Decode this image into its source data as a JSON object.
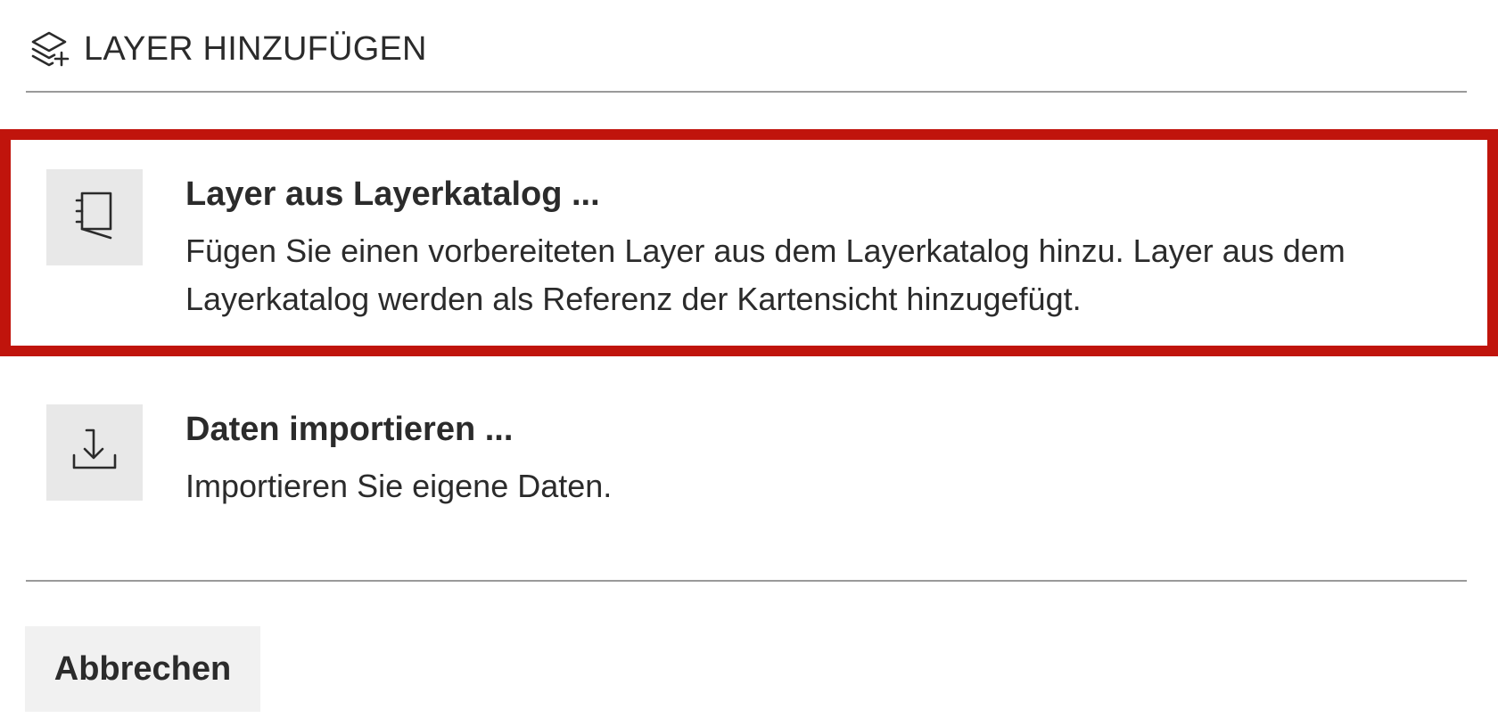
{
  "header": {
    "icon": "layers-add-icon",
    "title": "LAYER HINZUFÜGEN"
  },
  "options": [
    {
      "icon": "catalog-book-icon",
      "title": "Layer aus Layerkatalog ...",
      "description": "Fügen Sie einen vorbereiteten Layer aus dem Layerkatalog hinzu. Layer aus dem Layerkatalog werden als Referenz der Kartensicht hinzugefügt.",
      "highlighted": true
    },
    {
      "icon": "import-download-icon",
      "title": "Daten importieren ...",
      "description": "Importieren Sie eigene Daten.",
      "highlighted": false
    }
  ],
  "footer": {
    "cancel_label": "Abbrechen"
  },
  "colors": {
    "highlight_border": "#c0140c",
    "icon_box_bg": "#e8e8e8",
    "button_bg": "#f1f1f1",
    "divider": "#9a9a9a",
    "text": "#2b2b2b"
  }
}
